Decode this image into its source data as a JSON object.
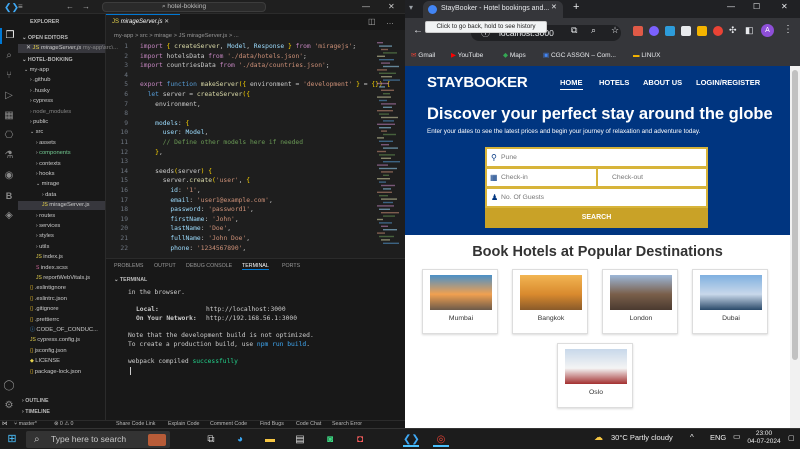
{
  "vscode": {
    "search": "hotel-bokking",
    "explorer_title": "EXPLORER",
    "open_editors": "OPEN EDITORS",
    "open_file": "mirageServer.js",
    "open_file_path": "my-app\\src\\...",
    "project": "HOTEL-BOKKING",
    "tree": [
      {
        "label": "my-app",
        "indent": 0,
        "kind": "folder-open"
      },
      {
        "label": ".github",
        "indent": 1,
        "kind": "folder"
      },
      {
        "label": ".husky",
        "indent": 1,
        "kind": "folder"
      },
      {
        "label": "cypress",
        "indent": 1,
        "kind": "folder"
      },
      {
        "label": "node_modules",
        "indent": 1,
        "kind": "folder-dim"
      },
      {
        "label": "public",
        "indent": 1,
        "kind": "folder"
      },
      {
        "label": "src",
        "indent": 1,
        "kind": "folder-open"
      },
      {
        "label": "assets",
        "indent": 2,
        "kind": "folder"
      },
      {
        "label": "components",
        "indent": 2,
        "kind": "folder-green"
      },
      {
        "label": "contexts",
        "indent": 2,
        "kind": "folder"
      },
      {
        "label": "hooks",
        "indent": 2,
        "kind": "folder"
      },
      {
        "label": "mirage",
        "indent": 2,
        "kind": "folder-open"
      },
      {
        "label": "data",
        "indent": 3,
        "kind": "folder"
      },
      {
        "label": "mirageServer.js",
        "indent": 3,
        "kind": "js-selected"
      },
      {
        "label": "routes",
        "indent": 2,
        "kind": "folder"
      },
      {
        "label": "services",
        "indent": 2,
        "kind": "folder"
      },
      {
        "label": "styles",
        "indent": 2,
        "kind": "folder"
      },
      {
        "label": "utils",
        "indent": 2,
        "kind": "folder"
      },
      {
        "label": "index.js",
        "indent": 2,
        "kind": "js"
      },
      {
        "label": "index.scss",
        "indent": 2,
        "kind": "scss"
      },
      {
        "label": "reportWebVitals.js",
        "indent": 2,
        "kind": "js"
      },
      {
        "label": ".eslintignore",
        "indent": 1,
        "kind": "cfg"
      },
      {
        "label": ".eslintrc.json",
        "indent": 1,
        "kind": "cfg"
      },
      {
        "label": ".gitignore",
        "indent": 1,
        "kind": "cfg"
      },
      {
        "label": ".prettierrc",
        "indent": 1,
        "kind": "cfg"
      },
      {
        "label": "CODE_OF_CONDUC...",
        "indent": 1,
        "kind": "md"
      },
      {
        "label": "cypress.config.js",
        "indent": 1,
        "kind": "js"
      },
      {
        "label": "jsconfig.json",
        "indent": 1,
        "kind": "cfg"
      },
      {
        "label": "LICENSE",
        "indent": 1,
        "kind": "lic"
      },
      {
        "label": "package-lock.json",
        "indent": 1,
        "kind": "cfg"
      }
    ],
    "outline": "OUTLINE",
    "timeline": "TIMELINE",
    "tab": "mirageServer.js",
    "breadcrumb": "my-app > src > mirage > JS mirageServer.js > ...",
    "code": [
      {
        "n": "1",
        "t": "import { createServer, Model, Response } from 'miragejs';"
      },
      {
        "n": "2",
        "t": "import hotelsData from './data/hotels.json';"
      },
      {
        "n": "3",
        "t": "import countriesData from './data/countries.json';"
      },
      {
        "n": "4",
        "t": ""
      },
      {
        "n": "5",
        "t": "export function makeServer({ environment = 'development' } = {}) {"
      },
      {
        "n": "6",
        "t": "  let server = createServer({"
      },
      {
        "n": "7",
        "t": "    environment,"
      },
      {
        "n": "8",
        "t": ""
      },
      {
        "n": "9",
        "t": "    models: {"
      },
      {
        "n": "10",
        "t": "      user: Model,"
      },
      {
        "n": "11",
        "t": "      // Define other models here if needed"
      },
      {
        "n": "12",
        "t": "    },"
      },
      {
        "n": "13",
        "t": ""
      },
      {
        "n": "14",
        "t": "    seeds(server) {"
      },
      {
        "n": "15",
        "t": "      server.create('user', {"
      },
      {
        "n": "16",
        "t": "        id: '1',"
      },
      {
        "n": "17",
        "t": "        email: 'user1@example.com',"
      },
      {
        "n": "18",
        "t": "        password: 'password1',"
      },
      {
        "n": "19",
        "t": "        firstName: 'John',"
      },
      {
        "n": "20",
        "t": "        lastName: 'Doe',"
      },
      {
        "n": "21",
        "t": "        fullName: 'John Doe',"
      },
      {
        "n": "22",
        "t": "        phone: '1234567890',"
      }
    ],
    "panel_tabs": [
      "PROBLEMS",
      "OUTPUT",
      "DEBUG CONSOLE",
      "TERMINAL",
      "PORTS"
    ],
    "terminal_label": "TERMINAL",
    "terminal": {
      "l1": "in the browser.",
      "local_label": "Local:",
      "local_url": "http://localhost:3000",
      "net_label": "On Your Network:",
      "net_url": "http://192.168.56.1:3000",
      "note1": "Note that the development build is not optimized.",
      "note2a": "To create a production build, use ",
      "note2b": "npm run build",
      "note2c": ".",
      "compiled_a": "webpack compiled ",
      "compiled_b": "successfully"
    },
    "status": {
      "branch": "master*",
      "problems": "⊗ 0 ⚠ 0",
      "items": [
        "Share Code Link",
        "Explain Code",
        "Comment Code",
        "Find Bugs",
        "Code Chat",
        "Search Error"
      ]
    }
  },
  "chrome": {
    "tab_title": "StayBooker - Hotel bookings and...",
    "url": "localhost:3000",
    "tooltip": "Click to go back, hold to see history",
    "bookmarks": [
      "Gmail",
      "YouTube",
      "Maps",
      "CGC ASSGN – Com...",
      "LINUX"
    ],
    "profile_initial": "A"
  },
  "site": {
    "logo": "STAYBOOKER",
    "nav": [
      "HOME",
      "HOTELS",
      "ABOUT US",
      "LOGIN/REGISTER"
    ],
    "hero_title": "Discover your perfect stay around the globe",
    "hero_sub": "Enter your dates to see the latest prices and begin your journey of relaxation and adventure today.",
    "destination_placeholder": "Pune",
    "checkin_placeholder": "Check-in",
    "checkout_placeholder": "Check-out",
    "guests_placeholder": "No. Of Guests",
    "search_label": "SEARCH",
    "popular_title": "Book Hotels at Popular Destinations",
    "cities": [
      "Mumbai",
      "Bangkok",
      "London",
      "Dubai",
      "Oslo"
    ]
  },
  "taskbar": {
    "search_placeholder": "Type here to search",
    "weather": "30°C  Partly cloudy",
    "lang": "ENG",
    "time": "23:00",
    "date": "04-07-2024"
  },
  "colors": {
    "vscode_accent": "#0078d4",
    "site_navy": "#003580",
    "site_gold": "#c9a227"
  }
}
